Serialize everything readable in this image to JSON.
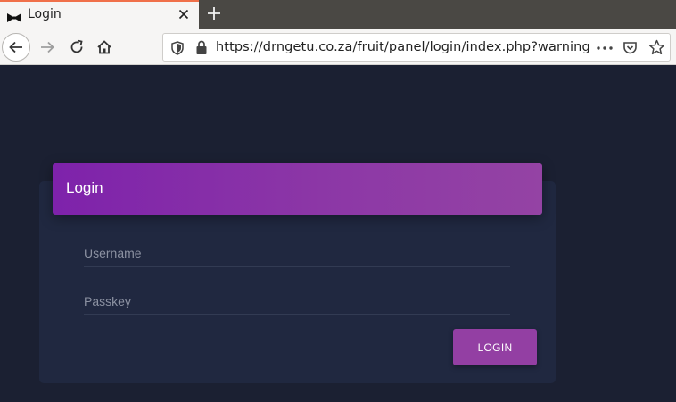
{
  "browser": {
    "tab": {
      "title": "Login",
      "favicon": "bowtie-icon"
    },
    "url": "https://drngetu.co.za/fruit/panel/login/index.php?warning"
  },
  "login": {
    "title": "Login",
    "username_placeholder": "Username",
    "passkey_placeholder": "Passkey",
    "button_label": "LOGIN"
  },
  "colors": {
    "accent": "#933fa3",
    "header_gradient_start": "#7e22ab",
    "page_bg": "#1b2032",
    "card_bg": "#202840"
  }
}
